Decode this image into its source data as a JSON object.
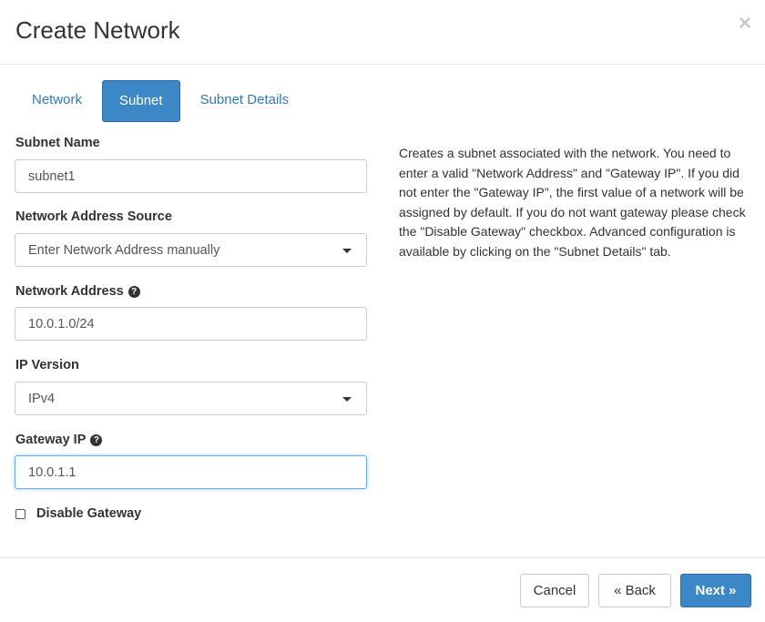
{
  "dialog": {
    "title": "Create Network",
    "close_symbol": "×"
  },
  "tabs": [
    {
      "label": "Network",
      "active": false
    },
    {
      "label": "Subnet",
      "active": true
    },
    {
      "label": "Subnet Details",
      "active": false
    }
  ],
  "form": {
    "subnet_name": {
      "label": "Subnet Name",
      "value": "subnet1"
    },
    "network_address_source": {
      "label": "Network Address Source",
      "value": "Enter Network Address manually"
    },
    "network_address": {
      "label": "Network Address",
      "value": "10.0.1.0/24"
    },
    "ip_version": {
      "label": "IP Version",
      "value": "IPv4"
    },
    "gateway_ip": {
      "label": "Gateway IP",
      "value": "10.0.1.1"
    },
    "disable_gateway": {
      "label": "Disable Gateway",
      "checked": false
    }
  },
  "help_text": "Creates a subnet associated with the network. You need to enter a valid \"Network Address\" and \"Gateway IP\". If you did not enter the \"Gateway IP\", the first value of a network will be assigned by default. If you do not want gateway please check the \"Disable Gateway\" checkbox. Advanced configuration is available by clicking on the \"Subnet Details\" tab.",
  "footer": {
    "cancel_label": "Cancel",
    "back_label": "« Back",
    "next_label": "Next »"
  },
  "icons": {
    "help": "question-circle-icon",
    "caret": "caret-down-icon",
    "close": "close-icon"
  },
  "colors": {
    "primary": "#3c87c6",
    "link": "#337ab7",
    "focus": "#66afe9"
  }
}
